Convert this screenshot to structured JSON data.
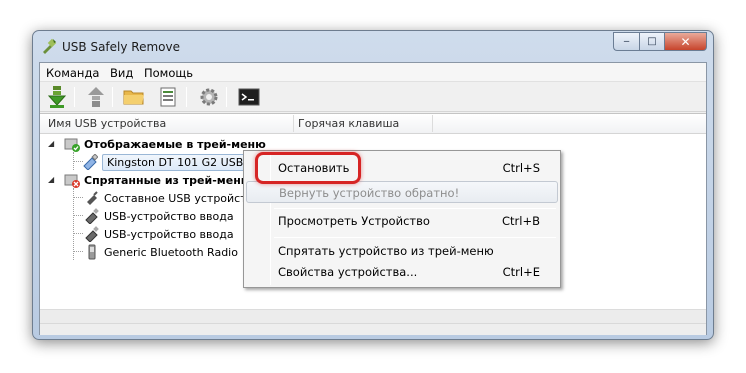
{
  "window": {
    "title": "USB Safely Remove",
    "controls": {
      "minimize": "‒",
      "maximize": "□",
      "close": "✕"
    }
  },
  "menu": [
    "Команда",
    "Вид",
    "Помощь"
  ],
  "toolbar": [
    "stop-device-icon",
    "restore-device-icon",
    "folder-icon",
    "device-list-icon",
    "gear-icon",
    "console-icon"
  ],
  "columns": {
    "device": "Имя USB устройства",
    "hotkey": "Горячая клавиша"
  },
  "tree": {
    "group_shown": "Отображаемые в трей-меню",
    "device_selected": "Kingston DT 101 G2 USB",
    "group_hidden": "Спрятанные из трей-меню",
    "hidden_items": [
      "Составное USB устройство",
      "USB-устройство ввода",
      "USB-устройство ввода",
      "Generic Bluetooth Radio"
    ]
  },
  "context_menu": {
    "stop": {
      "label": "Остановить",
      "shortcut": "Ctrl+S"
    },
    "return": {
      "label": "Вернуть устройство обратно!"
    },
    "view": {
      "label": "Просмотреть Устройство",
      "shortcut": "Ctrl+B"
    },
    "hide": {
      "label": "Спрятать устройство из трей-меню"
    },
    "props": {
      "label": "Свойства устройства...",
      "shortcut": "Ctrl+E"
    }
  },
  "colors": {
    "highlight": "#d62424",
    "selection": "#dce9f8"
  }
}
